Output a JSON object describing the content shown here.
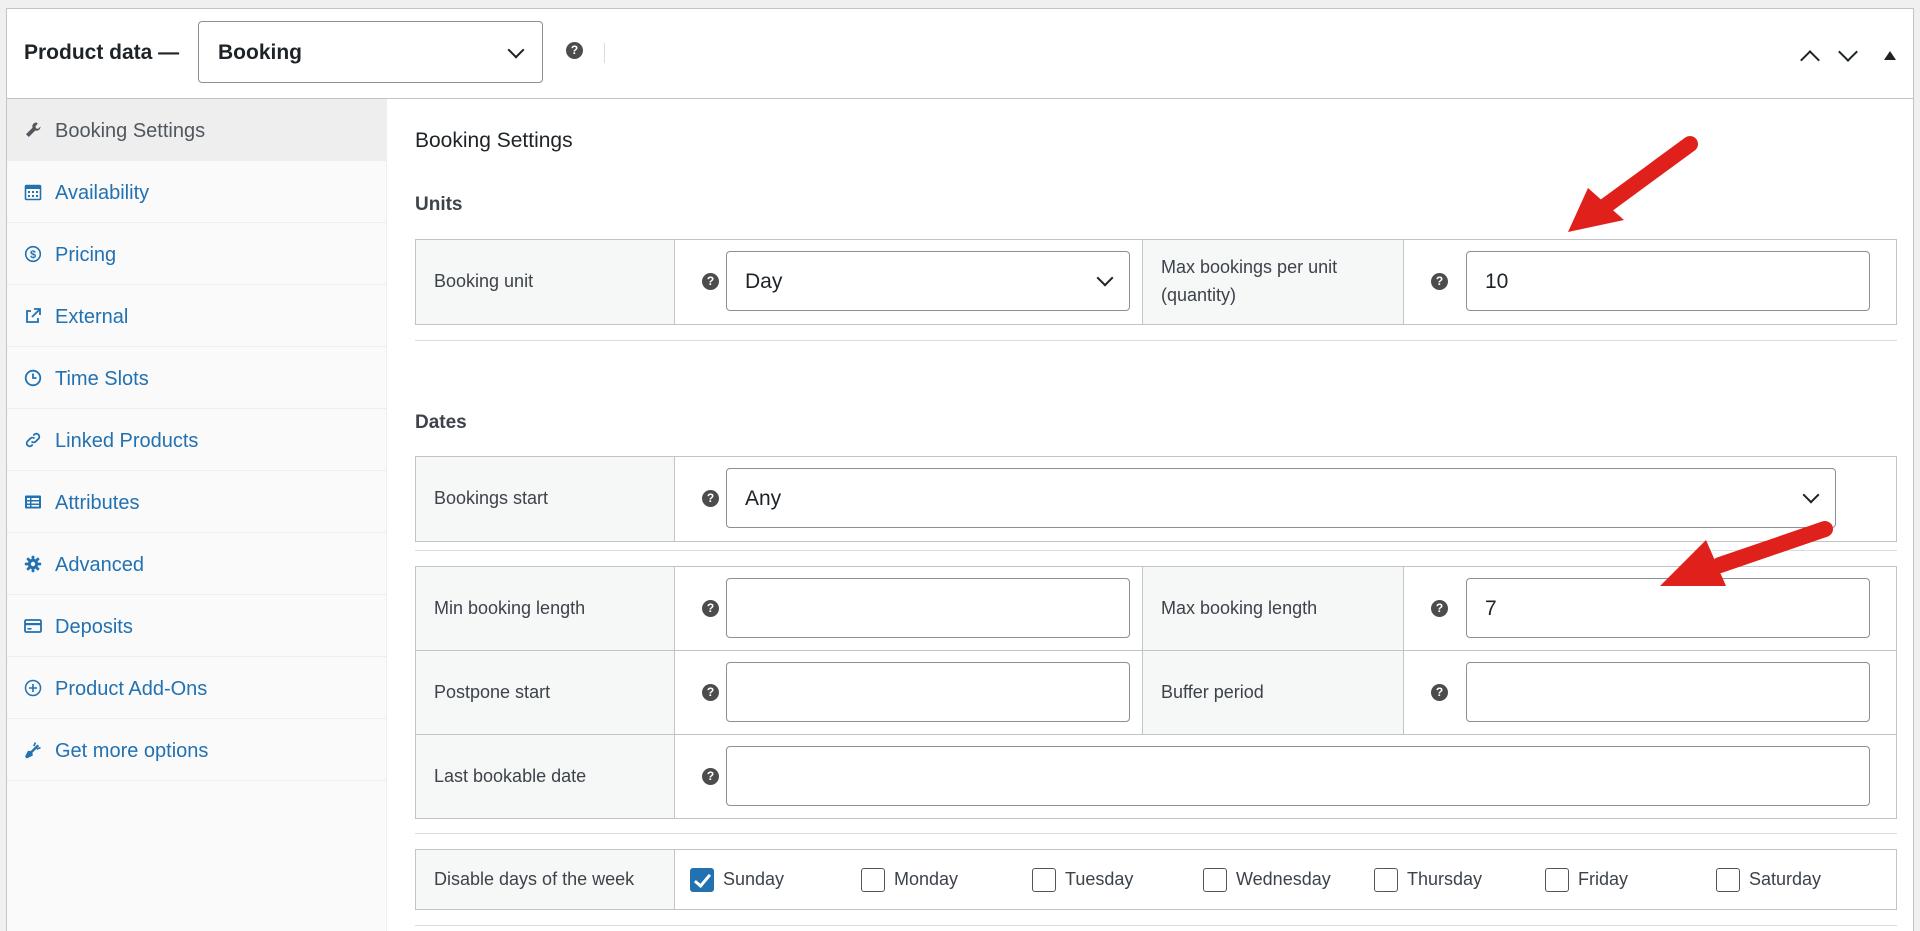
{
  "header": {
    "title": "Product data —",
    "product_type": "Booking",
    "help": "?"
  },
  "sidebar": {
    "tabs": [
      {
        "label": "Booking Settings",
        "icon": "wrench-icon",
        "active": true
      },
      {
        "label": "Availability",
        "icon": "calendar-icon"
      },
      {
        "label": "Pricing",
        "icon": "dollar-icon"
      },
      {
        "label": "External",
        "icon": "external-link-icon"
      },
      {
        "label": "Time Slots",
        "icon": "clock-icon"
      },
      {
        "label": "Linked Products",
        "icon": "link-icon"
      },
      {
        "label": "Attributes",
        "icon": "list-icon"
      },
      {
        "label": "Advanced",
        "icon": "gear-icon"
      },
      {
        "label": "Deposits",
        "icon": "card-icon"
      },
      {
        "label": "Product Add-Ons",
        "icon": "plus-circle-icon"
      },
      {
        "label": "Get more options",
        "icon": "plugin-icon"
      }
    ]
  },
  "main": {
    "heading": "Booking Settings",
    "units": {
      "title": "Units",
      "booking_unit_label": "Booking unit",
      "booking_unit_value": "Day",
      "max_bookings_label_line1": "Max bookings per unit",
      "max_bookings_label_line2": "(quantity)",
      "max_bookings_value": "10"
    },
    "dates": {
      "title": "Dates",
      "bookings_start_label": "Bookings start",
      "bookings_start_value": "Any",
      "min_length_label": "Min booking length",
      "min_length_value": "",
      "max_length_label": "Max booking length",
      "max_length_value": "7",
      "postpone_label": "Postpone start",
      "postpone_value": "",
      "buffer_label": "Buffer period",
      "buffer_value": "",
      "last_date_label": "Last bookable date",
      "last_date_value": ""
    },
    "disable_days": {
      "label": "Disable days of the week",
      "days": [
        {
          "name": "Sunday",
          "checked": true
        },
        {
          "name": "Monday",
          "checked": false
        },
        {
          "name": "Tuesday",
          "checked": false
        },
        {
          "name": "Wednesday",
          "checked": false
        },
        {
          "name": "Thursday",
          "checked": false
        },
        {
          "name": "Friday",
          "checked": false
        },
        {
          "name": "Saturday",
          "checked": false
        }
      ]
    }
  },
  "colors": {
    "accent": "#2271b1",
    "arrow": "#e0201b"
  }
}
